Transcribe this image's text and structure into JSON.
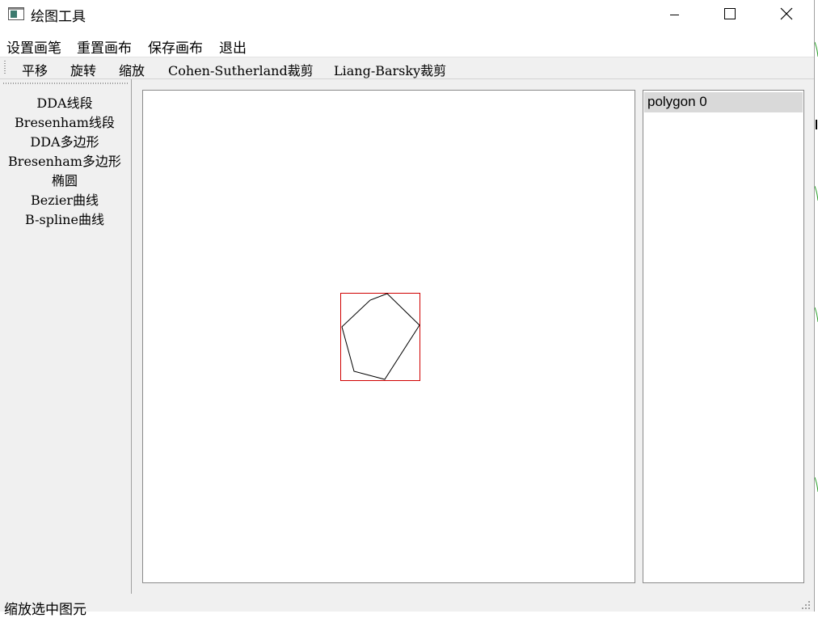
{
  "window": {
    "title": "绘图工具",
    "controls": {
      "minimize": "minimize-icon",
      "maximize": "maximize-icon",
      "close": "close-icon"
    }
  },
  "menubar": {
    "items": [
      "设置画笔",
      "重置画布",
      "保存画布",
      "退出"
    ]
  },
  "toolbar": {
    "items": [
      "平移",
      "旋转",
      "缩放",
      "Cohen-Sutherland裁剪",
      "Liang-Barsky裁剪"
    ]
  },
  "left_dock": {
    "items": [
      "DDA线段",
      "Bresenham线段",
      "DDA多边形",
      "Bresenham多边形",
      "椭圆",
      "Bezier曲线",
      "B-spline曲线"
    ]
  },
  "canvas": {
    "shape_type": "polygon",
    "stroke_color": "#000000",
    "selection_color": "#d00000",
    "background": "#ffffff"
  },
  "item_list": {
    "items": [
      {
        "label": "polygon 0",
        "selected": true
      }
    ],
    "selected_background": "#d9d9d9"
  },
  "statusbar": {
    "text": "缩放选中图元"
  }
}
